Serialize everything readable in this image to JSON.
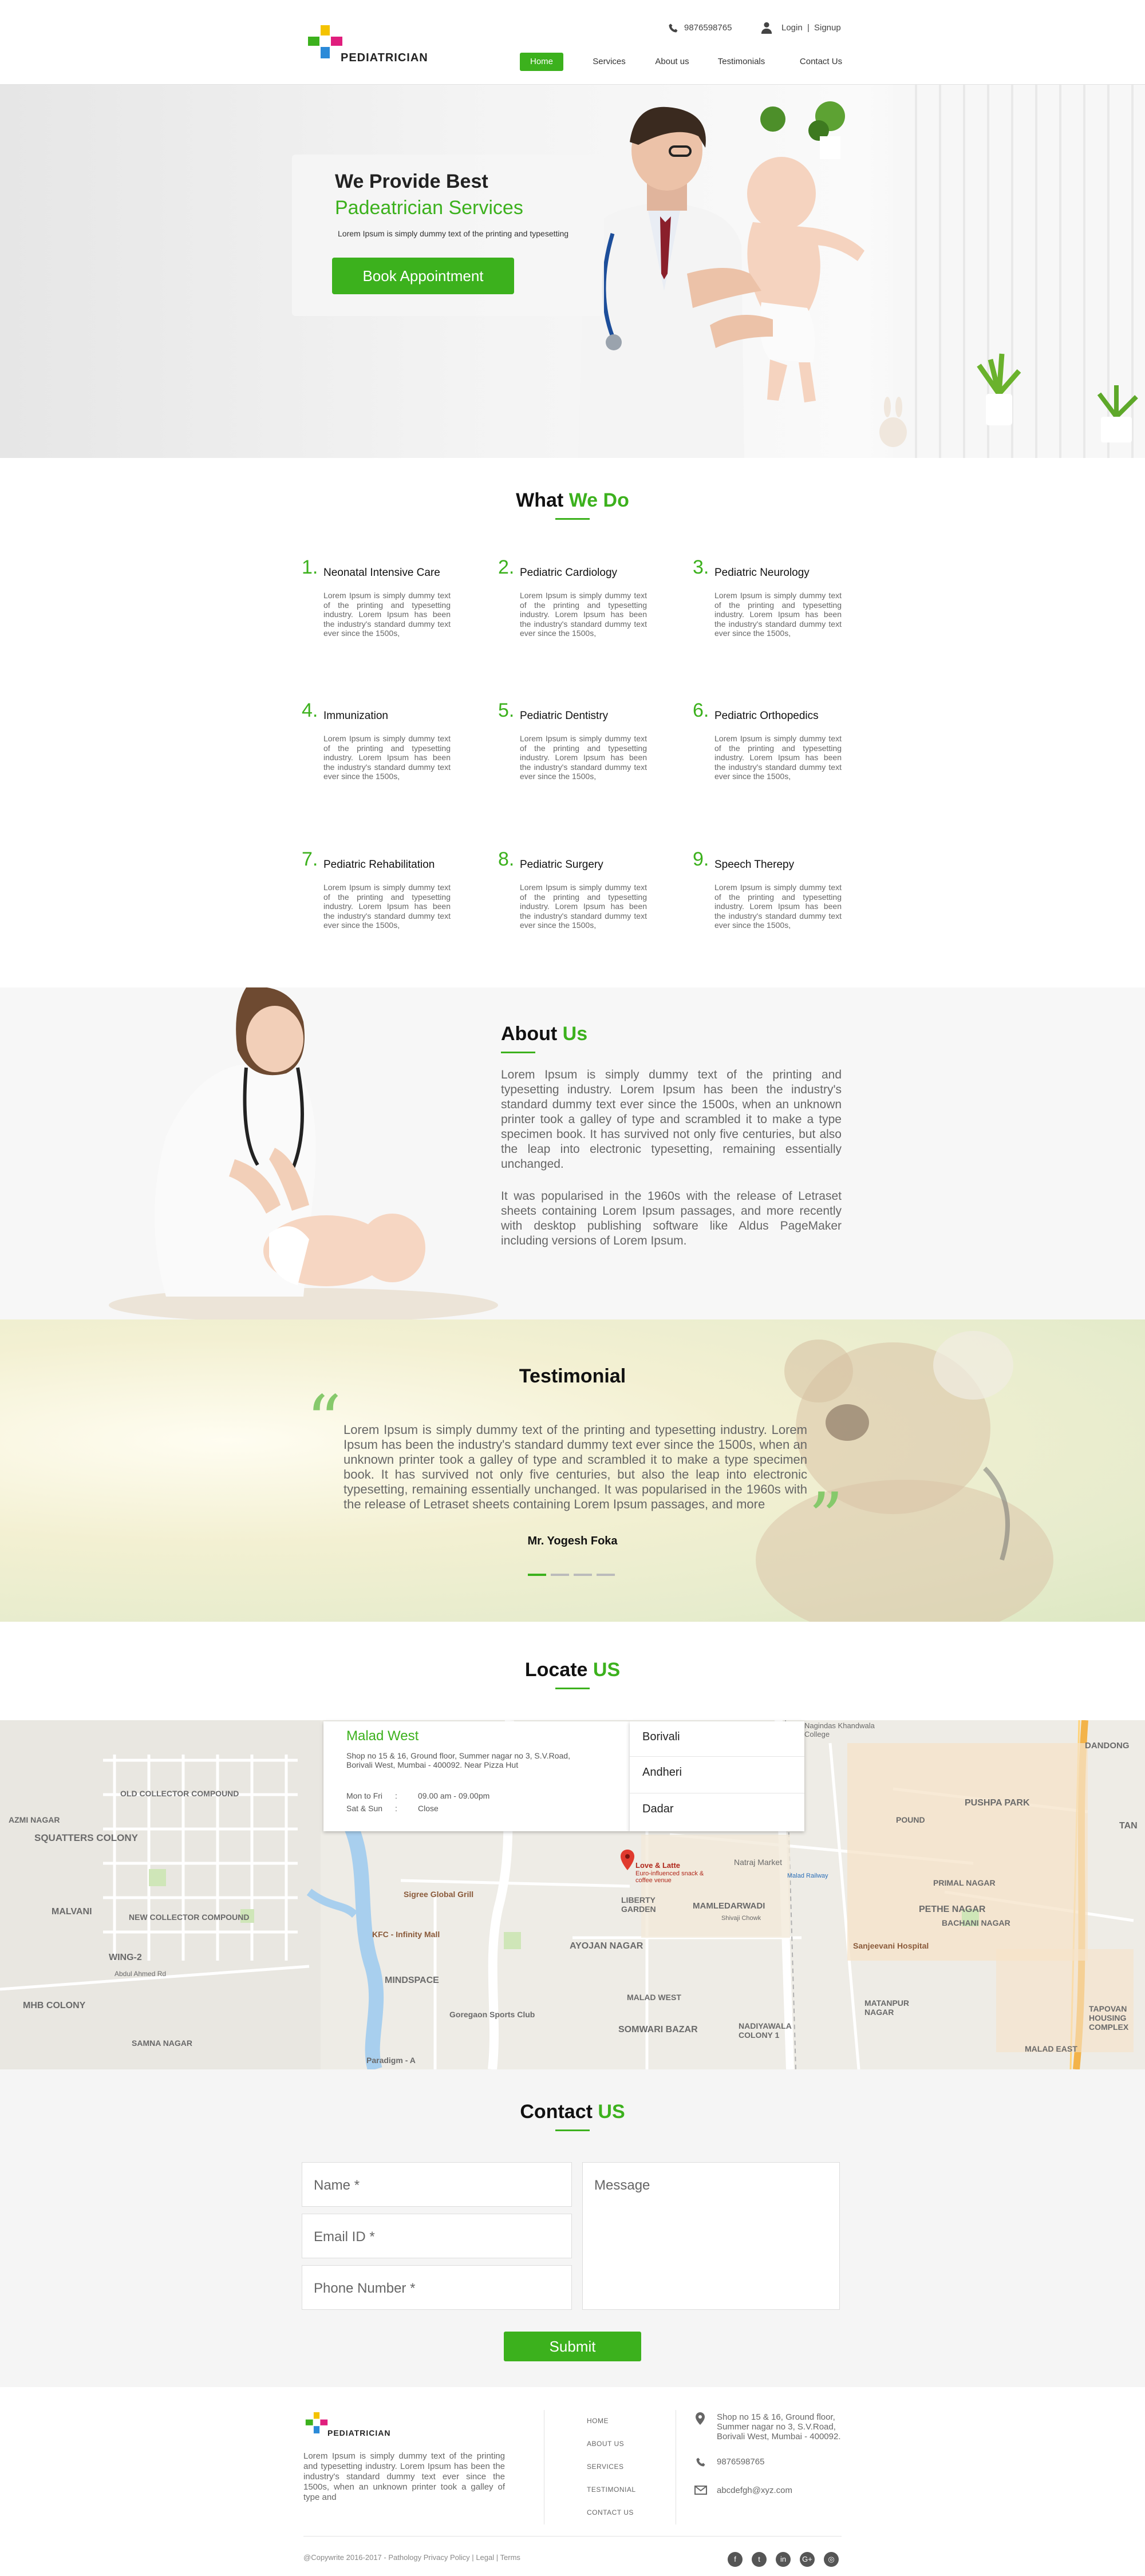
{
  "header": {
    "brand": "PEDIATRICIAN",
    "phone": "9876598765",
    "login": "Login",
    "separator": "|",
    "signup": "Signup",
    "nav": [
      {
        "label": "Home",
        "active": true
      },
      {
        "label": "Services",
        "active": false
      },
      {
        "label": "About us",
        "active": false
      },
      {
        "label": "Testimonials",
        "active": false
      },
      {
        "label": "Contact Us",
        "active": false
      }
    ]
  },
  "hero": {
    "title": "We Provide Best",
    "subtitle": "Padeatrician Services",
    "text": "Lorem Ipsum is simply dummy text of the printing and typesetting",
    "button": "Book Appointment"
  },
  "services": {
    "title_a": "What",
    "title_b": "We Do",
    "items": [
      {
        "num": "1.",
        "title": "Neonatal Intensive Care",
        "desc": "Lorem Ipsum is simply dummy text of the printing and typesetting industry. Lorem Ipsum has been the industry's standard dummy text ever since the 1500s,"
      },
      {
        "num": "2.",
        "title": "Pediatric Cardiology",
        "desc": "Lorem Ipsum is simply dummy text of the printing and typesetting industry. Lorem Ipsum has been the industry's standard dummy text ever since the 1500s,"
      },
      {
        "num": "3.",
        "title": "Pediatric Neurology",
        "desc": "Lorem Ipsum is simply dummy text of the printing and typesetting industry. Lorem Ipsum has been the industry's standard dummy text ever since the 1500s,"
      },
      {
        "num": "4.",
        "title": "Immunization",
        "desc": "Lorem Ipsum is simply dummy text of the printing and typesetting industry. Lorem Ipsum has been the industry's standard dummy text ever since the 1500s,"
      },
      {
        "num": "5.",
        "title": "Pediatric Dentistry",
        "desc": "Lorem Ipsum is simply dummy text of the printing and typesetting industry. Lorem Ipsum has been the industry's standard dummy text ever since the 1500s,"
      },
      {
        "num": "6.",
        "title": "Pediatric Orthopedics",
        "desc": "Lorem Ipsum is simply dummy text of the printing and typesetting industry. Lorem Ipsum has been the industry's standard dummy text ever since the 1500s,"
      },
      {
        "num": "7.",
        "title": "Pediatric Rehabilitation",
        "desc": "Lorem Ipsum is simply dummy text of the printing and typesetting industry. Lorem Ipsum has been the industry's standard dummy text ever since the 1500s,"
      },
      {
        "num": "8.",
        "title": "Pediatric Surgery",
        "desc": "Lorem Ipsum is simply dummy text of the printing and typesetting industry. Lorem Ipsum has been the industry's standard dummy text ever since the 1500s,"
      },
      {
        "num": "9.",
        "title": "Speech Therepy",
        "desc": "Lorem Ipsum is simply dummy text of the printing and typesetting industry. Lorem Ipsum has been the industry's standard dummy text ever since the 1500s,"
      }
    ]
  },
  "about": {
    "title_a": "About",
    "title_b": "Us",
    "p1": "Lorem Ipsum is simply dummy text of the printing and typesetting industry. Lorem Ipsum has been the industry's standard dummy text ever since the 1500s, when an unknown printer took a galley of type and scrambled it to make a type specimen book. It has survived not only five centuries, but also the leap into electronic typesetting, remaining essentially unchanged.",
    "p2": "It was popularised in the 1960s with the release of Letraset sheets containing Lorem Ipsum passages, and more recently with desktop publishing software like Aldus PageMaker including versions of Lorem Ipsum."
  },
  "testimonial": {
    "title": "Testimonial",
    "text": "Lorem Ipsum is simply dummy text of the printing and typesetting industry. Lorem Ipsum has been the industry's standard dummy text ever since the 1500s, when an unknown printer took a galley of type and scrambled it to make a type specimen book. It has survived not only five centuries, but also the leap into electronic typesetting, remaining essentially unchanged. It was popularised in the 1960s with the release of Letraset sheets containing Lorem Ipsum passages, and more",
    "author": "Mr. Yogesh Foka",
    "slides": 4,
    "active_slide": 1
  },
  "locate": {
    "title_a": "Locate",
    "title_b": "US",
    "branch": {
      "name": "Malad West",
      "address": "Shop no 15 & 16, Ground floor, Summer nagar no 3, S.V.Road, Borivali West, Mumbai - 400092. Near Pizza Hut",
      "hours": [
        {
          "days": "Mon to Fri",
          "sep": ":",
          "time": "09.00 am - 09.00pm"
        },
        {
          "days": "Sat & Sun",
          "sep": ":",
          "time": "Close"
        }
      ]
    },
    "branches": [
      "Borivali",
      "Andheri",
      "Dadar"
    ],
    "map_labels": {
      "old_collector": "OLD COLLECTOR COMPOUND",
      "azmi": "AZMI NAGAR",
      "squatters": "SQUATTERS COLONY",
      "malvani": "MALVANI",
      "new_collector": "NEW COLLECTOR COMPOUND",
      "wing2": "WING-2",
      "abdul": "Abdul Ahmed Rd",
      "mhb": "MHB COLONY",
      "samna": "SAMNA NAGAR",
      "sigree": "Sigree Global Grill",
      "kfc": "KFC - Infinity Mall",
      "mindspace": "MINDSPACE",
      "goregaon": "Goregaon Sports Club",
      "paradigm": "Paradigm - A",
      "liberty": "LIBERTY GARDEN",
      "ayojan": "AYOJAN NAGAR",
      "malad_west": "MALAD WEST",
      "somwari": "SOMWARI BAZAR",
      "nadiyawala": "NADIYAWALA COLONY 1",
      "mamledarwadi": "MAMLEDARWADI",
      "shivaji": "Shivaji Chowk",
      "natraj": "Natraj Market",
      "malad_rail": "Malad Railway",
      "nagindas": "Nagindas Khandwala College",
      "dandong": "DANDONG",
      "pushpa": "PUSHPA PARK",
      "pound": "POUND",
      "primal": "PRIMAL NAGAR",
      "pethe": "PETHE NAGAR",
      "bachani": "BACHANI NAGAR",
      "sanjeevani": "Sanjeevani Hospital",
      "matanpur": "MATANPUR NAGAR",
      "tapovan": "TAPOVAN HOUSING COMPLEX",
      "malad_east": "MALAD EAST",
      "tan": "TAN",
      "pin_name": "Love & Latte",
      "pin_desc": "Euro-influenced snack & coffee venue"
    }
  },
  "contact": {
    "title_a": "Contact",
    "title_b": "US",
    "name_ph": "Name *",
    "email_ph": "Email ID *",
    "phone_ph": "Phone Number *",
    "message_ph": "Message",
    "submit": "Submit"
  },
  "footer": {
    "brand": "PEDIATRICIAN",
    "about": "Lorem Ipsum is simply dummy text of the printing and typesetting industry. Lorem Ipsum has been the industry's standard dummy text ever since the 1500s, when an unknown printer took a galley of type and",
    "links": [
      "HOME",
      "ABOUT US",
      "SERVICES",
      "TESTIMONIAL",
      "CONTACT US"
    ],
    "address": "Shop no 15 & 16, Ground floor, Summer nagar no 3, S.V.Road, Borivali West, Mumbai - 400092.",
    "phone": "9876598765",
    "email": "abcdefgh@xyz.com",
    "copyright": "@Copywrite 2016-2017 - Pathology Privacy Policy",
    "legal": "Legal",
    "terms": "Terms",
    "bar": "|",
    "social": [
      {
        "icon": "facebook-icon",
        "glyph": "f"
      },
      {
        "icon": "twitter-icon",
        "glyph": "t"
      },
      {
        "icon": "linkedin-icon",
        "glyph": "in"
      },
      {
        "icon": "google-plus-icon",
        "glyph": "G+"
      },
      {
        "icon": "instagram-icon",
        "glyph": "◎"
      }
    ]
  },
  "colors": {
    "accent": "#3cb11d",
    "text": "#222222",
    "muted": "#666666"
  }
}
